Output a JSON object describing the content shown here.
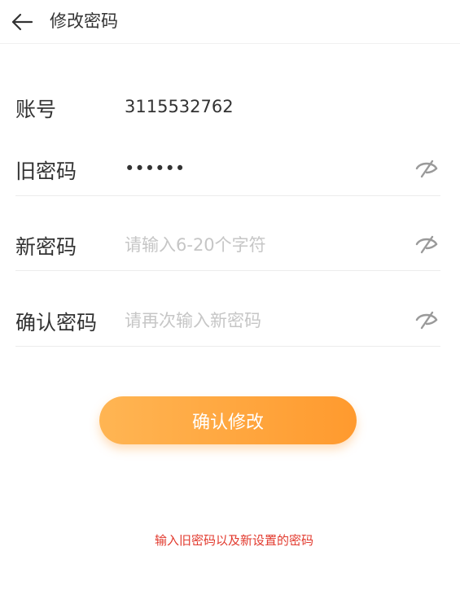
{
  "header": {
    "title": "修改密码",
    "back_icon": "arrow-left-icon"
  },
  "form": {
    "account": {
      "label": "账号",
      "value": "3115532762"
    },
    "old_password": {
      "label": "旧密码",
      "value": "••••••",
      "toggle_icon": "eye-off-icon"
    },
    "new_password": {
      "label": "新密码",
      "placeholder": "请输入6-20个字符",
      "toggle_icon": "eye-off-icon"
    },
    "confirm_password": {
      "label": "确认密码",
      "placeholder": "请再次输入新密码",
      "toggle_icon": "eye-off-icon"
    }
  },
  "actions": {
    "confirm_label": "确认修改"
  },
  "hint": {
    "text": "输入旧密码以及新设置的密码",
    "color": "#e23a2e"
  },
  "colors": {
    "button_gradient_start": "#ffb553",
    "button_gradient_end": "#ff9a2e",
    "placeholder": "#c6c6c6"
  }
}
